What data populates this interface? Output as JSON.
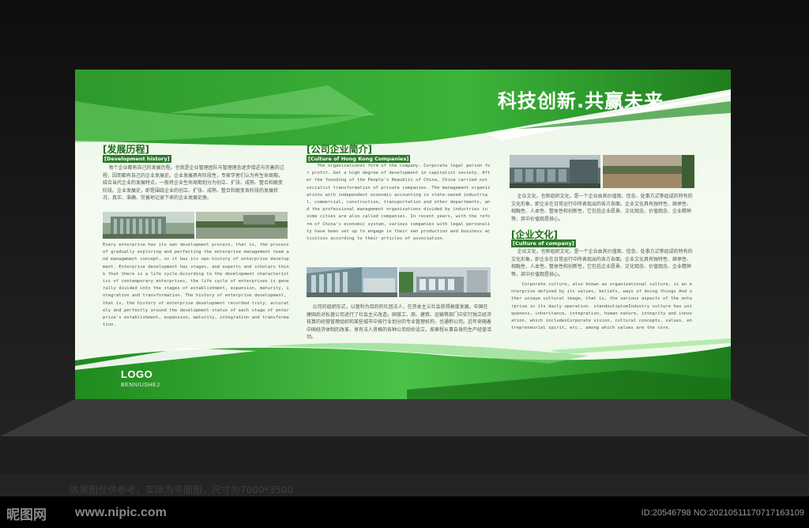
{
  "slogan": "科技创新.共赢未来",
  "logo": {
    "text": "LOGO",
    "sub": "BENNIUSHEJ"
  },
  "section1": {
    "title": "[发展历程]",
    "subtitle": "[Development history]",
    "intro_cn": "    每个企业都有自己的发展历程。也就是企业管理团队与管理理念逐步接近与完善的过程，因而都有自己的企业发展史。企业发展具有阶段性，专家学者们认为有生命周期，结合当代企业的发展特点，一般将企业生命周期划分为创立、扩张、成熟、整合和蜕变阶段。企业发展史，即是围绕企业的创立、扩张、成熟、整合和蜕变各阶段的发展状况，真实、准确、完善地记录下来的企业发展史册。",
    "body_en": "Every enterprise has its own development process, that is, the process of gradually exploring and perfecting the enterprise management team and management concept, so it has its own history of enterprise development. Enterprise development has stages, and experts and scholars think that there is a life cycle.According to the development characteristics of contemporary enterprises, the life cycle of enterprises is generally divided into the stages of establishment, expansion, maturity, integration and transformation. The history of enterprise development, that is, the history of enterprise development recorded truly, accurately and perfectly around the development status of each stage of enterprise's establishment, expansion, maturity, integration and transformation."
  },
  "section2": {
    "title": "[公司企业简介]",
    "subtitle": "[Culture of Hong Kong Companies]",
    "body_en": "    The organizational form of the company. Corporate legal person for profit. Get a high degree of development in capitalist society. After the founding of the People's Republic of China, China carried out socialist transformation of private companies. The management organizations with independent economic accounting in state-owned industrial, commercial, construction, transportation and other departments, and the professional management organizations divided by industries in some cities are also called companies. In recent years, with the reform of China's economic system, various companies with legal personality have been set up to engage in their own production and business activities according to their articles of association.",
    "body_cn": "    公司的组织形式，以营利为目的的社团法人，在资本主义社会获得高度发展。中国在建国后对私营公司进行了社会主义改造。国营工、商、建筑、运输等部门中实行独立经济核算的经营管理组织和某些城市中按行业划分的专业管理机构，也通称公司。近年来随着中国经济体制的改革，享有法人资格的各种公司纷纷设立，按章程从事自身的生产经营活动。"
  },
  "section3": {
    "intro_cn": "    企业文化，也称组织文化，是一个企业由其价值观、信念、处事方式等组成的特有的文化形象，即企业在日常运行中所表现出的各方各面。企业文化具有独特性、继承性、相融性、人本性、整体性和创新性，它包括企业愿景、文化观念、价值观念、企业精神等，其中价值观是核心。",
    "title": "[企业文化]",
    "subtitle": "[Culture of company]",
    "body_cn": "    企业文化，也称组织文化，是一个企业由其价值观、信念、处事方式等组成的特有的文化形象，即企业在日常运行中所表现出的各方各面。企业文化具有独特性、继承性、相融性、人本性、整体性和创新性，它包括企业愿景、文化观念、价值观念、企业精神等，其中价值观是核心。",
    "body_en": "    Corporate culture, also known as organizational culture, is an enterprise defined by its values, beliefs, ways of doing things And other unique cultural image, that is, the various aspects of the enterprise in its daily operation. standoutiptoeIndustry culture has uniqueness, inheritance, integration, human nature, integrity and innovation, which includesCorporate vision, cultural concepts, values, entrepreneurial spirit, etc., among which values are the core."
  },
  "footnote": "效果图仅供参考，实际为平面图，尺寸为7000*3500",
  "watermark": {
    "site": "昵图网",
    "url": "www.nipic.com",
    "id": "ID:20546798 NO:20210511170717163109"
  }
}
